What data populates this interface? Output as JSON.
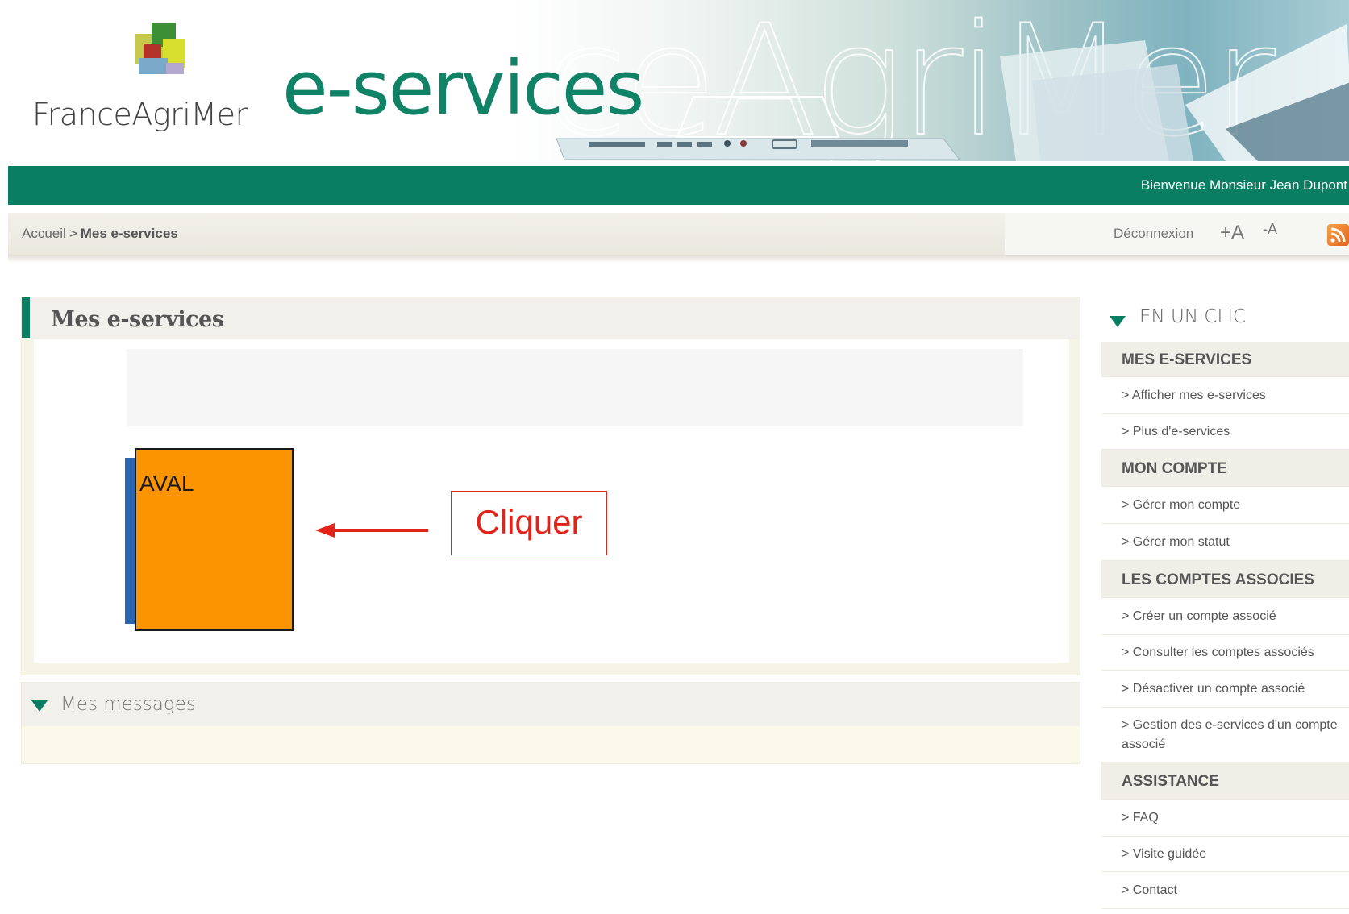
{
  "header": {
    "logo_text": "FranceAgriMer",
    "title": "e-services",
    "welcome": "Bienvenue Monsieur Jean Dupont"
  },
  "breadcrumb": {
    "home": "Accueil",
    "separator": ">",
    "current": "Mes e-services"
  },
  "toolbar": {
    "logout": "Déconnexion",
    "font_increase": "+A",
    "font_decrease": "-A",
    "rss_icon": "rss-icon"
  },
  "main": {
    "title": "Mes e-services",
    "tile_label": "AVAL",
    "tile_color": "#fc9402",
    "annotation": "Cliquer",
    "annotation_color": "#e2231a"
  },
  "messages": {
    "title": "Mes messages"
  },
  "sidebar": {
    "title": "EN UN CLIC",
    "sections": [
      {
        "label": "MES E-SERVICES",
        "links": [
          "> Afficher mes e-services",
          "> Plus d'e-services"
        ]
      },
      {
        "label": "MON COMPTE",
        "links": [
          "> Gérer mon compte",
          "> Gérer mon statut"
        ]
      },
      {
        "label": "LES COMPTES ASSOCIES",
        "links": [
          "> Créer un compte associé",
          "> Consulter les comptes associés",
          "> Désactiver un compte associé",
          "> Gestion des e-services d'un compte associé"
        ]
      },
      {
        "label": "ASSISTANCE",
        "links": [
          "> FAQ",
          "> Visite guidée",
          "> Contact"
        ]
      }
    ]
  },
  "colors": {
    "brand_green": "#0a7e62",
    "tile_stripe": "#2a66b0"
  }
}
